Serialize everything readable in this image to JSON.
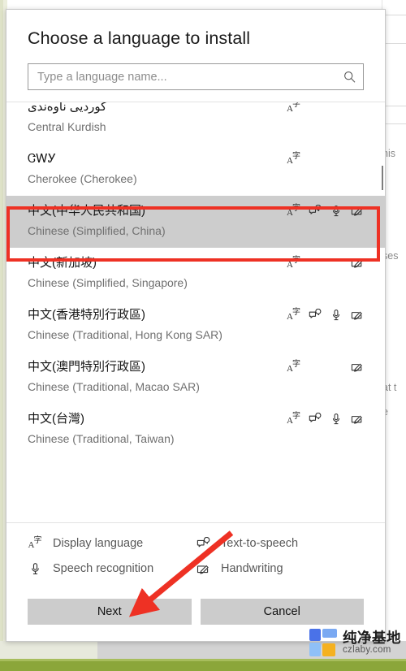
{
  "dialog": {
    "title": "Choose a language to install",
    "search": {
      "placeholder": "Type a language name...",
      "value": "",
      "icon": "search-icon"
    },
    "languages": [
      {
        "native": "کوردیی ناوەندی",
        "english": "Central Kurdish",
        "features": [
          "display",
          "",
          "",
          ""
        ],
        "selected": false,
        "clipped_top": true
      },
      {
        "native": "ᏣᎳᎩ",
        "english": "Cherokee (Cherokee)",
        "features": [
          "display",
          "",
          "",
          ""
        ],
        "selected": false
      },
      {
        "native": "中文(中华人民共和国)",
        "english": "Chinese (Simplified, China)",
        "features": [
          "display",
          "tts",
          "speech",
          "handwriting"
        ],
        "selected": true
      },
      {
        "native": "中文(新加坡)",
        "english": "Chinese (Simplified, Singapore)",
        "features": [
          "display",
          "",
          "",
          "handwriting"
        ],
        "selected": false
      },
      {
        "native": "中文(香港特別行政區)",
        "english": "Chinese (Traditional, Hong Kong SAR)",
        "features": [
          "display",
          "tts",
          "speech",
          "handwriting"
        ],
        "selected": false
      },
      {
        "native": "中文(澳門特別行政區)",
        "english": "Chinese (Traditional, Macao SAR)",
        "features": [
          "display",
          "",
          "",
          "handwriting"
        ],
        "selected": false
      },
      {
        "native": "中文(台灣)",
        "english": "Chinese (Traditional, Taiwan)",
        "features": [
          "display",
          "tts",
          "speech",
          "handwriting"
        ],
        "selected": false
      }
    ],
    "legend": [
      {
        "icon": "display-language-icon",
        "label": "Display language"
      },
      {
        "icon": "text-to-speech-icon",
        "label": "Text-to-speech"
      },
      {
        "icon": "speech-recognition-icon",
        "label": "Speech recognition"
      },
      {
        "icon": "handwriting-icon",
        "label": "Handwriting"
      }
    ],
    "buttons": {
      "primary": "Next",
      "secondary": "Cancel"
    }
  },
  "background": {
    "text_fragments": [
      "his",
      "ses",
      "at t",
      "e"
    ]
  },
  "annotations": {
    "highlight_box_color": "#ee3124",
    "arrow_color": "#ee3124",
    "arrow_points_to": "Next"
  },
  "watermark": {
    "name_cn": "纯净基地",
    "name_en": "czlaby.com"
  }
}
